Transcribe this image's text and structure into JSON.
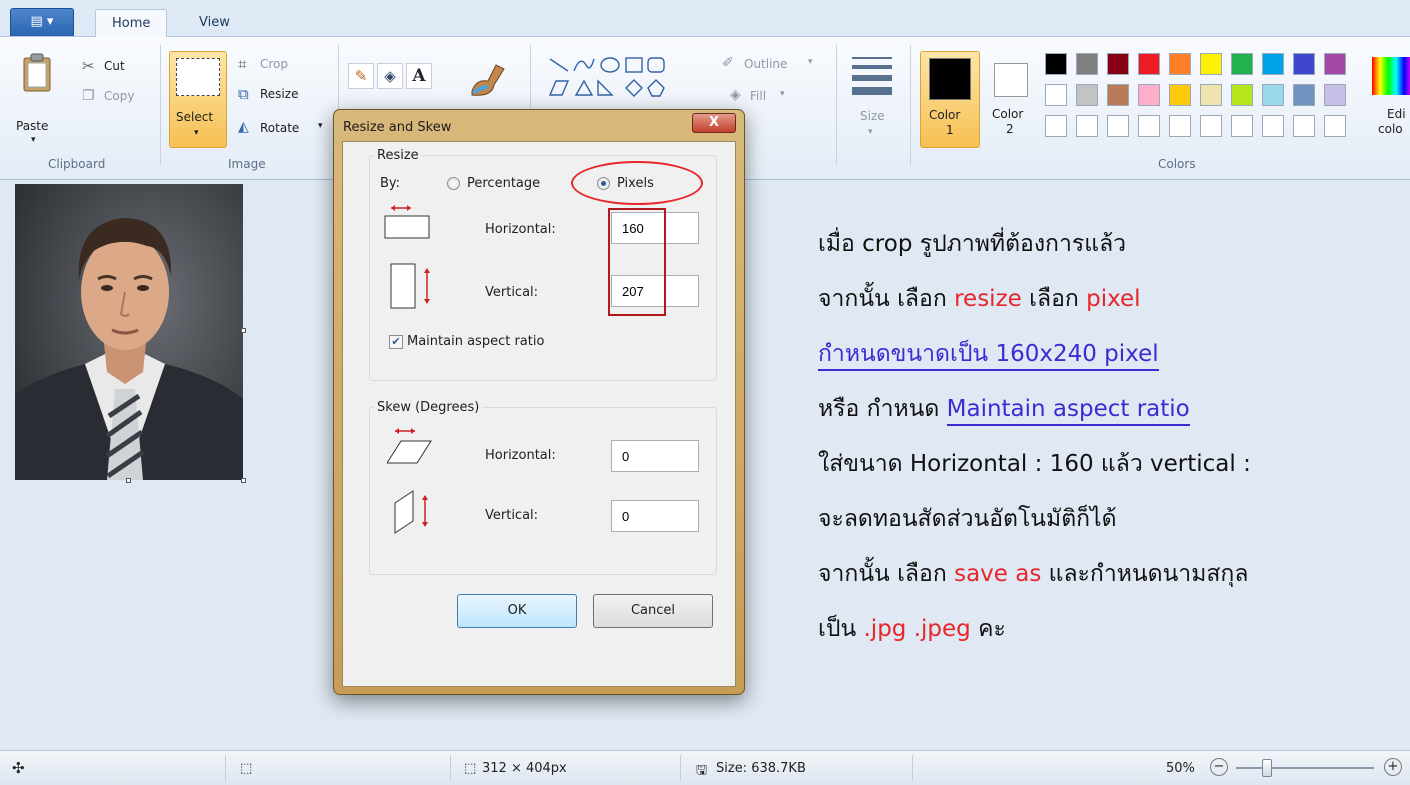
{
  "ribbon": {
    "app_menu_label": "▤ ▾",
    "tabs": [
      {
        "label": "Home"
      },
      {
        "label": "View"
      }
    ],
    "clipboard": {
      "paste": "Paste",
      "cut": "Cut",
      "copy": "Copy",
      "group": "Clipboard"
    },
    "image": {
      "select": "Select",
      "crop": "Crop",
      "resize": "Resize",
      "rotate": "Rotate",
      "group": "Image"
    },
    "shapes": {
      "outline": "Outline",
      "fill": "Fill"
    },
    "size": "Size",
    "color1": {
      "line1": "Color",
      "line2": "1"
    },
    "color2": {
      "line1": "Color",
      "line2": "2"
    },
    "colors_group": "Colors",
    "edit_colors_line1": "Edi",
    "edit_colors_line2": "colo",
    "palette_row1": [
      "#000000",
      "#7f7f7f",
      "#880015",
      "#ed1c24",
      "#ff7f27",
      "#fff200",
      "#22b14c",
      "#00a2e8",
      "#3f48cc",
      "#a349a4"
    ],
    "palette_row2": [
      "#ffffff",
      "#c3c3c3",
      "#b97a57",
      "#ffaec9",
      "#ffc90e",
      "#efe4b0",
      "#b5e61d",
      "#99d9ea",
      "#7092be",
      "#c8bfe7"
    ]
  },
  "dialog": {
    "title": "Resize and Skew",
    "close": "X",
    "resize_legend": "Resize",
    "by_label": "By:",
    "percentage": "Percentage",
    "pixels": "Pixels",
    "horizontal_label": "Horizontal:",
    "vertical_label": "Vertical:",
    "resize_h_value": "160",
    "resize_v_value": "207",
    "maintain_aspect": "Maintain aspect ratio",
    "skew_legend": "Skew (Degrees)",
    "skew_h_value": "0",
    "skew_v_value": "0",
    "ok": "OK",
    "cancel": "Cancel"
  },
  "instructions": {
    "l1": "เมื่อ crop รูปภาพที่ต้องการแล้ว",
    "l2a": "จากนั้น เลือก ",
    "l2b": "resize",
    "l2c": " เลือก ",
    "l2d": "pixel",
    "l3": "กำหนดขนาดเป็น 160x240 pixel",
    "l4a": "หรือ กำหนด ",
    "l4b": "Maintain aspect ratio",
    "l5": "ใส่ขนาด Horizontal : 160 แล้ว vertical :",
    "l6": "จะลดทอนสัดส่วนอัตโนมัติก็ได้",
    "l7a": "จากนั้น เลือก ",
    "l7b": "save as",
    "l7c": " และกำหนดนามสกุล",
    "l8a": "เป็น ",
    "l8b": ".jpg .jpeg",
    "l8c": " คะ"
  },
  "status": {
    "move_icon": "✣",
    "selection_icon": "⬚",
    "dimensions": "312 × 404px",
    "size": "Size: 638.7KB",
    "zoom": "50%",
    "zoom_out": "−",
    "zoom_in": "+"
  }
}
